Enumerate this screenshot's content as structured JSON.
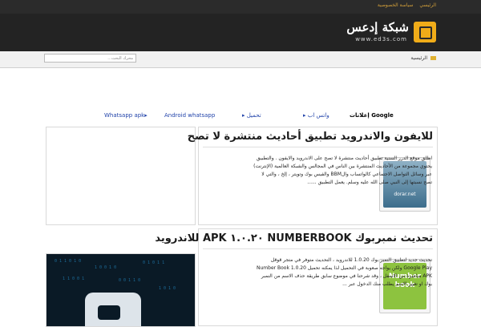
{
  "topbar": {
    "links": [
      "الرئيسي",
      "سياسة الخصوصية"
    ]
  },
  "header": {
    "site_title": "شبكة إدعس",
    "site_url": "www.ed3s.com",
    "logo_icon": "logo-box-icon"
  },
  "nav": {
    "home_label": "الرئيسية",
    "search_placeholder": "محرك البحث..."
  },
  "menu": {
    "items": [
      {
        "label": "إعلانات Google"
      },
      {
        "label": "▸ واتس اب"
      },
      {
        "label": "▸ تحميل"
      },
      {
        "label": "Android whatsapp"
      },
      {
        "label": "Whatsapp apk▸"
      }
    ]
  },
  "posts": [
    {
      "title": "للايفون والاندرويد تطبيق أحاديث منتشرة لا تصح",
      "excerpt": "اطلق موقع الدرر السنية تطبيق أحاديث منتشرة لا تصح على الاندرويد والايفون . والتطبيق يحتوي مجموعة من الأحاديث المنتشرة بين الناس في المجالس والشبكة العالمية (الإنترنت) عبر وسائل التواصل الاجتماعي كالواتساب والBBM والفيس بوك وتويتر ، إلخ ، والتي لا تصح نسبتها إلى النبي صلى الله عليه وسلم. يعمل التطبيق ......",
      "thumb_label": "dorar.net"
    },
    {
      "title": "تحديث نمبربوك NUMBERBOOK ١.٠.٢٠ APK للاندرويد",
      "excerpt": "تحديث جديد لتطبيق النمبر بوك 1.0.20 للاندرويد ، التحديث متوفر في متجر قوقل Google Play ولكن يواجه صعوبة في التحميل لذا يمكنه تحميل Number Book 1.0.20 APK مباشرة من الاسفل ، وقد شرحنا في موضوع سابق طريقة حذف الاسم من النمبر بوك او تغيير الاسم يطلب منك الدخول عبر ...",
      "thumb_label": "Number book"
    }
  ]
}
